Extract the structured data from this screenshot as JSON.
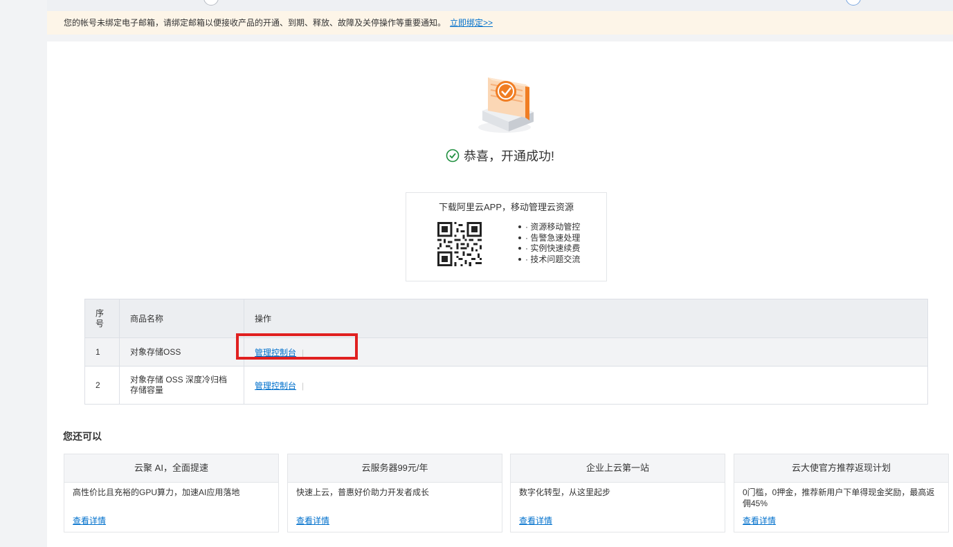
{
  "notice": {
    "text": "您的帐号未绑定电子邮箱，请绑定邮箱以便接收产品的开通、到期、释放、故障及关停操作等重要通知。",
    "link": "立即绑定>>"
  },
  "success": {
    "message": "恭喜，开通成功!"
  },
  "app_promo": {
    "title": "下载阿里云APP，移动管理云资源",
    "features": [
      "· 资源移动管控",
      "· 告警急速处理",
      "· 实例快速续费",
      "· 技术问题交流"
    ]
  },
  "table": {
    "headers": {
      "seq": "序号",
      "name": "商品名称",
      "action": "操作"
    },
    "rows": [
      {
        "seq": "1",
        "name": "对象存储OSS",
        "action": "管理控制台"
      },
      {
        "seq": "2",
        "name": "对象存储 OSS 深度冷归档存储容量",
        "action": "管理控制台"
      }
    ]
  },
  "more": {
    "title": "您还可以",
    "cards": [
      {
        "title": "云聚 AI，全面提速",
        "desc": "高性价比且充裕的GPU算力，加速AI应用落地",
        "link": "查看详情"
      },
      {
        "title": "云服务器99元/年",
        "desc": "快速上云，普惠好价助力开发者成长",
        "link": "查看详情"
      },
      {
        "title": "企业上云第一站",
        "desc": "数字化转型，从这里起步",
        "link": "查看详情"
      },
      {
        "title": "云大使官方推荐返现计划",
        "desc": "0门槛，0押金，推荐新用户下单得现金奖励，最高返佣45%",
        "link": "查看详情"
      }
    ]
  },
  "colors": {
    "link": "#0070cc",
    "success": "#1e8e3e",
    "notice_bg": "#fdf5e8",
    "highlight": "#e02020",
    "accent_orange": "#f07d23"
  }
}
